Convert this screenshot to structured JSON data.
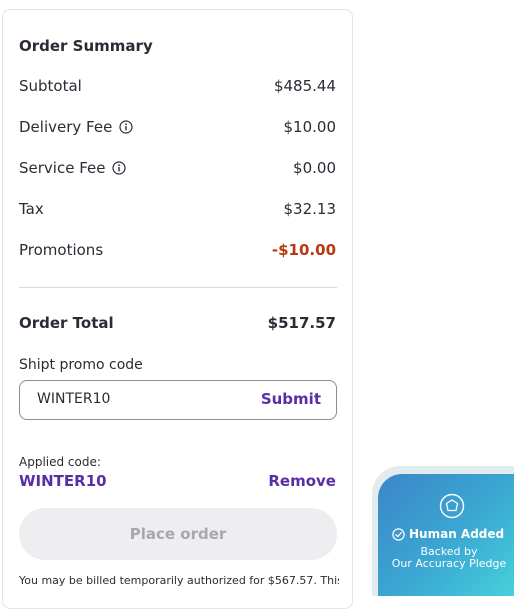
{
  "summary": {
    "title": "Order Summary",
    "rows": [
      {
        "label": "Subtotal",
        "value": "$485.44"
      },
      {
        "label": "Delivery Fee",
        "value": "$10.00"
      },
      {
        "label": "Service Fee",
        "value": "$0.00"
      },
      {
        "label": "Tax",
        "value": "$32.13"
      },
      {
        "label": "Promotions",
        "value": "-$10.00"
      }
    ],
    "total_label": "Order Total",
    "total_value": "$517.57"
  },
  "promo": {
    "label": "Shipt promo code",
    "input_value": "WINTER10",
    "submit_label": "Submit",
    "applied_label": "Applied code:",
    "applied_code": "WINTER10",
    "remove_label": "Remove"
  },
  "checkout": {
    "place_order_label": "Place order",
    "disclaimer": "You may be billed temporarily authorized for $567.57. This"
  },
  "badge": {
    "title": "Human Added",
    "line1": "Backed by",
    "line2": "Our Accuracy Pledge"
  },
  "icons": {
    "info": "info-icon",
    "shield": "shield-icon",
    "check": "check-circle-icon"
  },
  "colors": {
    "accent": "#5a2da6",
    "promotion": "#b8380f",
    "badge_gradient_start": "#3b86c9",
    "badge_gradient_end": "#47d6dc"
  }
}
